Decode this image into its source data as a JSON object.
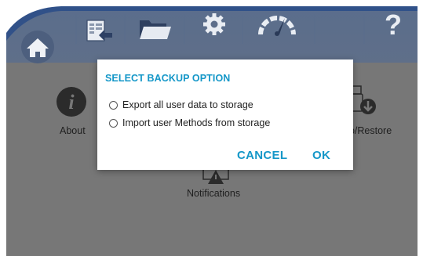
{
  "nav": {
    "icons": [
      "home-icon",
      "transfer-icon",
      "folder-icon",
      "gear-icon",
      "gauge-icon",
      "help-icon"
    ],
    "help_label": "?"
  },
  "grid": {
    "about_label": "About",
    "backup_label": "up/Restore",
    "notifications_label": "Notifications"
  },
  "dialog": {
    "title": "SELECT BACKUP OPTION",
    "options": [
      "Export all user data to storage",
      "Import user Methods from storage"
    ],
    "cancel_label": "CANCEL",
    "ok_label": "OK"
  },
  "colors": {
    "accent": "#1497c8",
    "overlay": "#777777",
    "nav_blue": "#123a78"
  }
}
